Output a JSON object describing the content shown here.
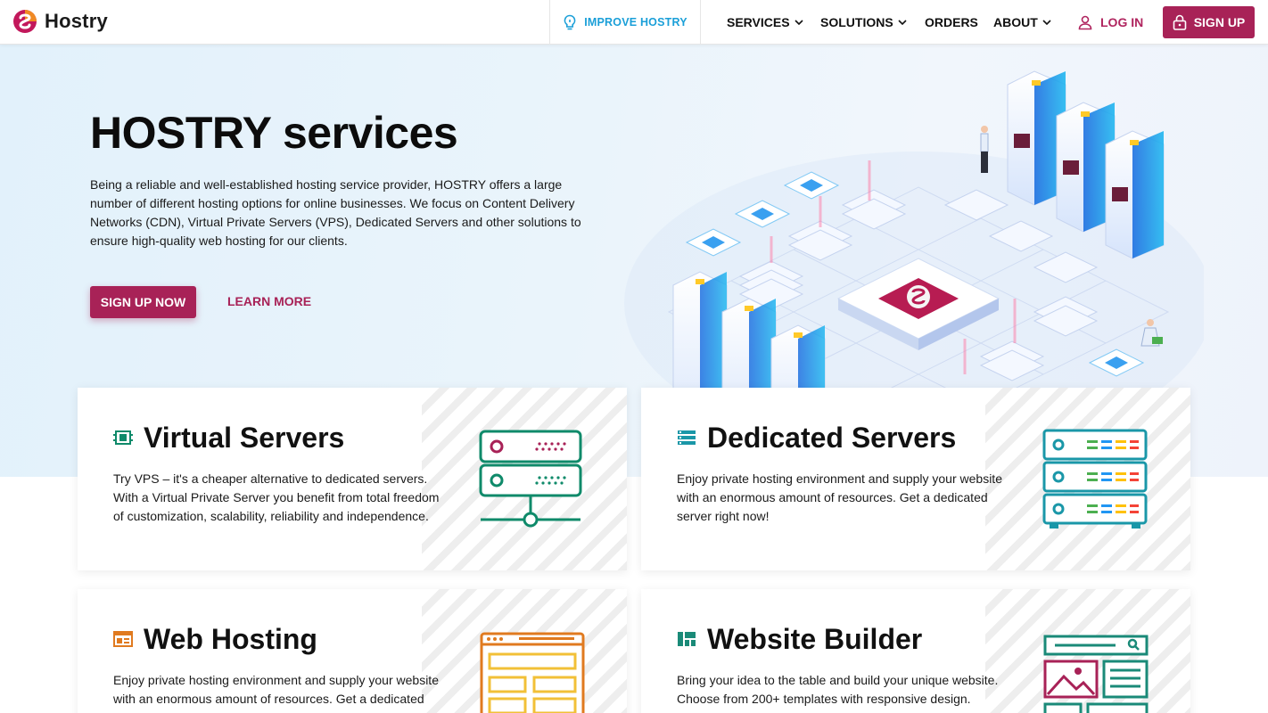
{
  "brand": {
    "name": "Hostry",
    "accent": "#a82257",
    "info": "#1a9fd8"
  },
  "header": {
    "improve_label": "IMPROVE HOSTRY",
    "nav": [
      {
        "label": "SERVICES",
        "has_dropdown": true
      },
      {
        "label": "SOLUTIONS",
        "has_dropdown": true
      },
      {
        "label": "ORDERS",
        "has_dropdown": false
      },
      {
        "label": "ABOUT",
        "has_dropdown": true
      }
    ],
    "login_label": "LOG IN",
    "signup_label": "SIGN UP"
  },
  "hero": {
    "title": "HOSTRY services",
    "description": "Being a reliable and well-established hosting service provider, HOSTRY offers a large number of different hosting options for online businesses. We focus on Content Delivery Networks (CDN), Virtual Private Servers (VPS), Dedicated Servers and other solutions to ensure high-quality web hosting for our clients.",
    "primary_cta": "SIGN UP NOW",
    "secondary_cta": "LEARN MORE"
  },
  "cards": [
    {
      "title": "Virtual Servers",
      "icon": "chip-icon",
      "color": "#0f8a6a",
      "description": "Try VPS – it's a cheaper alternative to dedicated servers. With a Virtual Private Server you benefit from total freedom of customization, scalability, reliability and independence."
    },
    {
      "title": "Dedicated Servers",
      "icon": "server-list-icon",
      "color": "#1a97a8",
      "description": "Enjoy private hosting environment and supply your website with an enormous amount of resources. Get a dedicated server right now!"
    },
    {
      "title": "Web Hosting",
      "icon": "browser-icon",
      "color": "#e07a1f",
      "description": "Enjoy private hosting environment and supply your website with an enormous amount of resources. Get a dedicated server right now!"
    },
    {
      "title": "Website Builder",
      "icon": "layout-icon",
      "color": "#1a8a78",
      "description": "Bring your idea to the table and build your unique website. Choose from 200+ templates with responsive design."
    }
  ]
}
